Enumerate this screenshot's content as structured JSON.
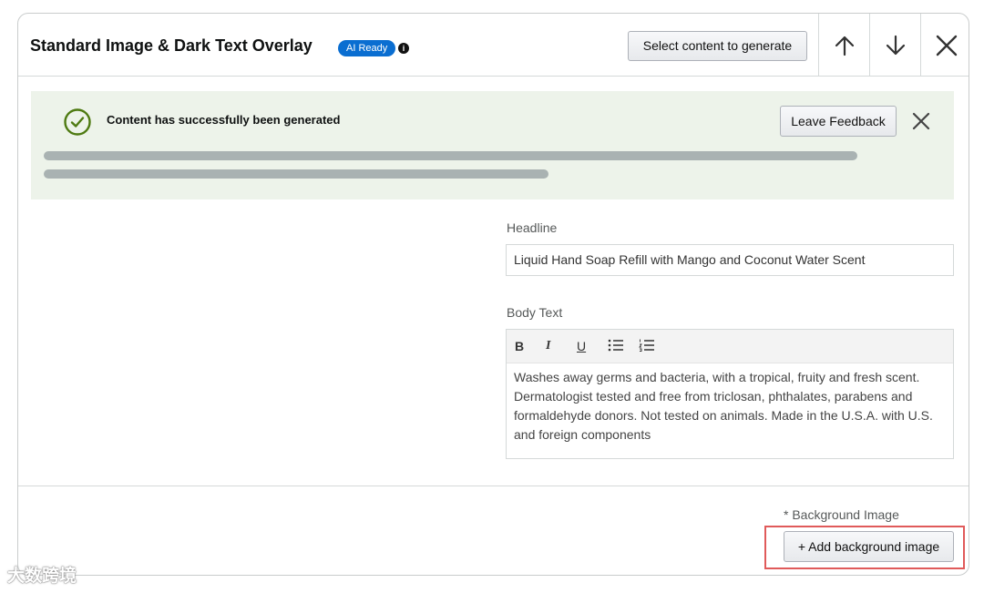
{
  "header": {
    "title": "Standard Image & Dark Text Overlay",
    "badge": "AI Ready",
    "info_icon": "info-icon",
    "select_button": "Select content to generate",
    "icons": [
      "arrow-up-icon",
      "arrow-down-icon",
      "close-icon"
    ]
  },
  "banner": {
    "message": "Content has successfully been generated",
    "feedback_button": "Leave Feedback",
    "icons": [
      "check-circle-icon",
      "close-icon"
    ],
    "background_color": "#edf3ea"
  },
  "form": {
    "headline_label": "Headline",
    "headline_value": "Liquid Hand Soap Refill with Mango and Coconut Water Scent",
    "body_label": "Body Text",
    "toolbar": {
      "bold": "B",
      "italic": "I",
      "underline": "U",
      "bullet_list": "☰",
      "numbered_list": "☰"
    },
    "body_value": "Washes away germs and bacteria, with a tropical, fruity and fresh scent. Dermatologist tested and free from triclosan, phthalates, parabens and formaldehyde donors. Not tested on animals. Made in the U.S.A. with U.S. and foreign components"
  },
  "footer": {
    "background_label": "* Background Image",
    "add_background_button": "+ Add background image"
  },
  "watermark": "大数跨境",
  "colors": {
    "accent": "#0a6ed1",
    "success": "#4e7a12",
    "highlight": "#e05a5a"
  }
}
